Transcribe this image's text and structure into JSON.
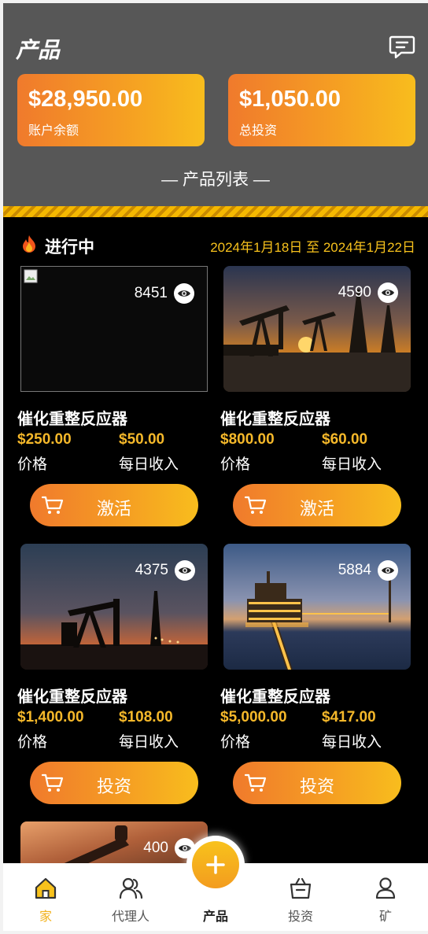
{
  "header": {
    "title": "产品",
    "balance": {
      "value": "$28,950.00",
      "label": "账户余额"
    },
    "total_investment": {
      "value": "$1,050.00",
      "label": "总投资"
    },
    "list_title": "— 产品列表 —"
  },
  "status": {
    "label": "进行中",
    "date_range": "2024年1月18日 至 2024年1月22日"
  },
  "products": [
    {
      "name": "催化重整反应器",
      "views": "8451",
      "price": "$250.00",
      "price_label": "价格",
      "daily": "$50.00",
      "daily_label": "每日收入",
      "button": "激活",
      "image": "broken"
    },
    {
      "name": "催化重整反应器",
      "views": "4590",
      "price": "$800.00",
      "price_label": "价格",
      "daily": "$60.00",
      "daily_label": "每日收入",
      "button": "激活",
      "image": "pumpjacks-sunset"
    },
    {
      "name": "催化重整反应器",
      "views": "4375",
      "price": "$1,400.00",
      "price_label": "价格",
      "daily": "$108.00",
      "daily_label": "每日收入",
      "button": "投资",
      "image": "pumpjack-dusk"
    },
    {
      "name": "催化重整反应器",
      "views": "5884",
      "price": "$5,000.00",
      "price_label": "价格",
      "daily": "$417.00",
      "daily_label": "每日收入",
      "button": "投资",
      "image": "offshore-platform"
    },
    {
      "views": "400",
      "image": "pumpjack-closeup"
    }
  ],
  "nav": {
    "home": "家",
    "agent": "代理人",
    "products": "产品",
    "investment": "投资",
    "mine": "矿"
  },
  "colors": {
    "accent_orange": "#f07a2c",
    "accent_yellow": "#f8bd1d",
    "price_gold": "#f5b82a",
    "header_gray": "#575757"
  }
}
